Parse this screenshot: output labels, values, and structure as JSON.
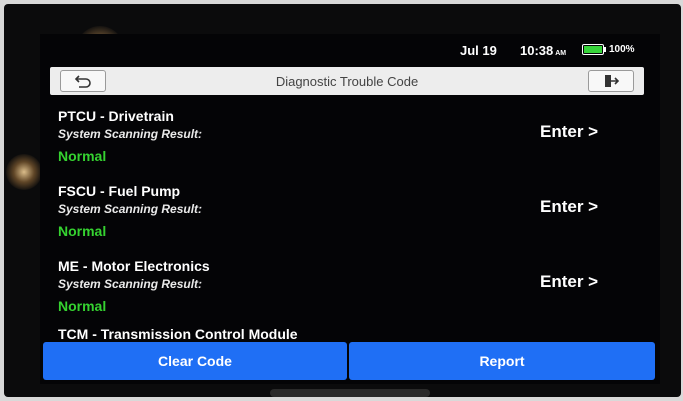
{
  "status_bar": {
    "date": "Jul 19",
    "time": "10:38",
    "ampm": "AM",
    "battery_percent": "100%",
    "battery_level": 1.0,
    "battery_color": "#37d43a"
  },
  "header": {
    "title": "Diagnostic Trouble Code",
    "back_icon": "back-arrow-icon",
    "exit_icon": "exit-icon"
  },
  "modules": [
    {
      "title": "PTCU - Drivetrain",
      "subtitle": "System Scanning Result:",
      "status": "Normal",
      "action": "Enter >"
    },
    {
      "title": "FSCU - Fuel Pump",
      "subtitle": "System Scanning Result:",
      "status": "Normal",
      "action": "Enter >"
    },
    {
      "title": "ME - Motor Electronics",
      "subtitle": "System Scanning Result:",
      "status": "Normal",
      "action": "Enter >"
    },
    {
      "title": "TCM - Transmission Control Module"
    }
  ],
  "bottom_bar": {
    "clear_label": "Clear Code",
    "report_label": "Report",
    "accent_color": "#1f6ff5"
  },
  "colors": {
    "status_normal": "#35d230"
  }
}
